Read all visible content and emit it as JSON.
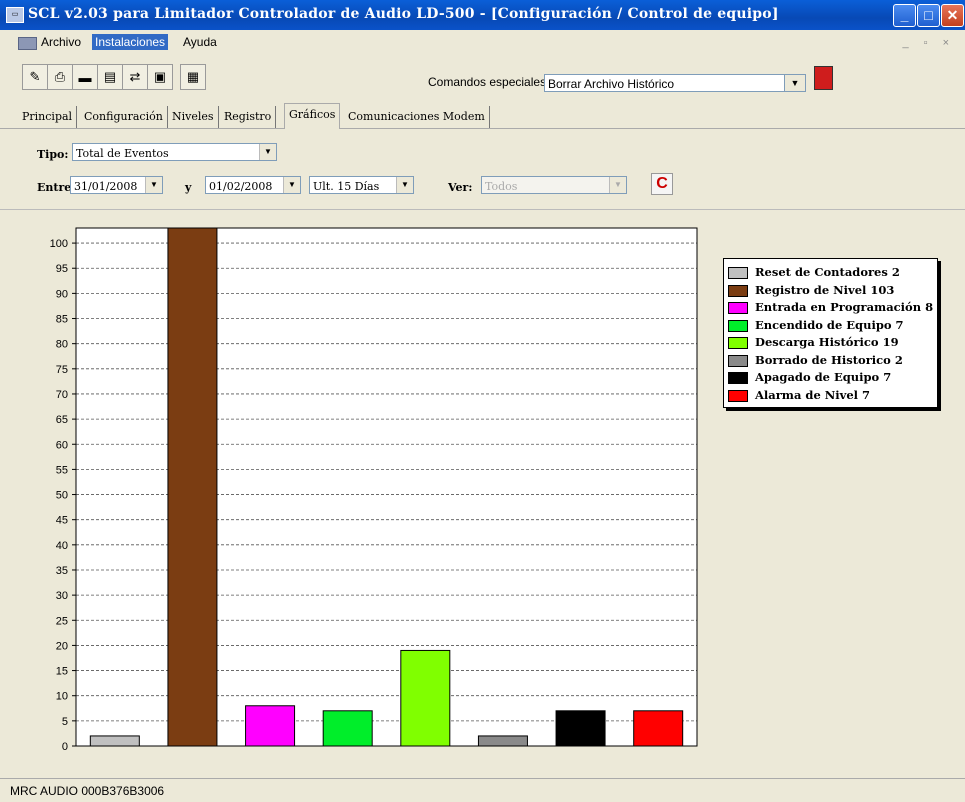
{
  "window": {
    "title": "SCL v2.03 para Limitador Controlador de Audio LD-500 - [Configuración / Control de equipo]"
  },
  "menu": {
    "items": [
      "Archivo",
      "Instalaciones",
      "Ayuda"
    ]
  },
  "toolbar": {
    "tools": [
      {
        "name": "open-tool-icon",
        "glyph": "✎"
      },
      {
        "name": "print-tool-icon",
        "glyph": "⎙"
      },
      {
        "name": "on-tool-icon",
        "glyph": "▬"
      },
      {
        "name": "send-tool-icon",
        "glyph": "▤"
      },
      {
        "name": "modem-tool-icon",
        "glyph": "⇄"
      },
      {
        "name": "save-tool-icon",
        "glyph": "▣"
      },
      {
        "name": "report-tool-icon",
        "glyph": "▦"
      }
    ],
    "commands_label": "Comandos especiales:",
    "commands_value": "Borrar Archivo Histórico"
  },
  "tabs": [
    "Principal",
    "Configuración",
    "Niveles",
    "Registro",
    "Gráficos",
    "Comunicaciones Modem"
  ],
  "active_tab": "Gráficos",
  "filters": {
    "tipo_label": "Tipo:",
    "tipo_value": "Total de Eventos",
    "entre_label": "Entre:",
    "date_from": "31/01/2008",
    "y_label": "y",
    "date_to": "01/02/2008",
    "range_value": "Ult. 15 Días",
    "ver_label": "Ver:",
    "ver_value": "Todos"
  },
  "chart_data": {
    "type": "bar",
    "categories": [
      "Reset de Contadores",
      "Registro de Nivel",
      "Entrada en Programación",
      "Encendido de Equipo",
      "Descarga Histórico",
      "Borrado de Historico",
      "Apagado de Equipo",
      "Alarma de Nivel"
    ],
    "values": [
      2,
      103,
      8,
      7,
      19,
      2,
      7,
      7
    ],
    "colors": [
      "#c0c0c0",
      "#7b3d12",
      "#ff00ff",
      "#00ee2a",
      "#80ff00",
      "#8a8a8a",
      "#000000",
      "#ff0000"
    ],
    "ylim": [
      0,
      103
    ],
    "yticks": [
      0,
      5,
      10,
      15,
      20,
      25,
      30,
      35,
      40,
      45,
      50,
      55,
      60,
      65,
      70,
      75,
      80,
      85,
      90,
      95,
      100
    ],
    "grid": true,
    "legend_position": "right",
    "legend": [
      "Reset de Contadores 2",
      "Registro de Nivel 103",
      "Entrada en Programación 8",
      "Encendido de Equipo 7",
      "Descarga Histórico 19",
      "Borrado de Historico 2",
      "Apagado de Equipo 7",
      "Alarma de Nivel 7"
    ]
  },
  "status": {
    "text": "MRC AUDIO 000B376B3006"
  }
}
